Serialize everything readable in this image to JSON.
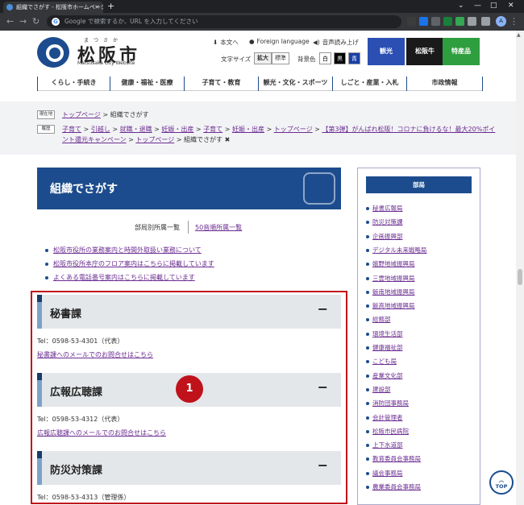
{
  "browser": {
    "tab_title": "組織でさがす - 松阪市ホームページ",
    "tab_close": "×",
    "new_tab": "+",
    "window_controls": [
      "⌄",
      "—",
      "□",
      "✕"
    ],
    "nav": [
      "←",
      "→",
      "↻"
    ],
    "omnibox_placeholder": "Google で検索するか、URL を入力してください",
    "google_glyph": "G",
    "profile_initial": "A"
  },
  "header": {
    "logo_ruby": "まつさか",
    "logo_name": "松阪市",
    "logo_sub": "Matsusaka City Website",
    "utils": [
      {
        "icon": "download-icon",
        "glyph": "⬇",
        "label": "本文へ"
      },
      {
        "icon": "globe-icon",
        "glyph": "●",
        "label": "Foreign language"
      },
      {
        "icon": "speaker-icon",
        "glyph": "◀)",
        "label": "音声読み上げ"
      }
    ],
    "font_size_label": "文字サイズ",
    "font_sizes": [
      "拡大",
      "標準"
    ],
    "bg_color_label": "背景色",
    "bg_colors": [
      {
        "label": "白",
        "bg": "#ffffff",
        "fg": "#000000"
      },
      {
        "label": "黒",
        "bg": "#000000",
        "fg": "#ffffff"
      },
      {
        "label": "青",
        "bg": "#1a3fa8",
        "fg": "#ffffff"
      }
    ],
    "banners": [
      {
        "label": "観光",
        "color": "#2b4fb3"
      },
      {
        "label": "松阪牛",
        "color": "#1a1a1a"
      },
      {
        "label": "特産品",
        "color": "#2e9e3e"
      }
    ]
  },
  "gnav": [
    "くらし・手続き",
    "健康・福祉・医療",
    "子育て・教育",
    "観光・文化・スポーツ",
    "しごと・産業・入札",
    "市政情報"
  ],
  "breadcrumbs": {
    "current_tag": "現在地",
    "history_tag": "履歴",
    "current": [
      {
        "text": "トップページ",
        "link": true
      },
      {
        "text": " > 組織でさがす",
        "link": false
      }
    ],
    "history": [
      {
        "text": "子育て",
        "link": true
      },
      {
        "text": " > ",
        "link": false
      },
      {
        "text": "引越し",
        "link": true
      },
      {
        "text": " > ",
        "link": false
      },
      {
        "text": "就職・退職",
        "link": true
      },
      {
        "text": " > ",
        "link": false
      },
      {
        "text": "妊娠・出産",
        "link": true
      },
      {
        "text": " > ",
        "link": false
      },
      {
        "text": "子育て",
        "link": true
      },
      {
        "text": " > ",
        "link": false
      },
      {
        "text": "妊娠・出産",
        "link": true
      },
      {
        "text": " > ",
        "link": false
      },
      {
        "text": "トップページ",
        "link": true
      },
      {
        "text": " > ",
        "link": false
      },
      {
        "text": "【第3弾】がんばれ松阪！コロナに負けるな！最大20%ポイント還元キャンペーン",
        "link": true
      },
      {
        "text": " > ",
        "link": false
      },
      {
        "text": "トップページ",
        "link": true
      },
      {
        "text": " > 組織でさがす ",
        "link": false
      }
    ],
    "clear_icon": "✖"
  },
  "main": {
    "title": "組織でさがす",
    "subtabs": [
      "部局別所属一覧",
      "50音順所属一覧"
    ],
    "links": [
      "松阪市役所の業務案内と時間外取扱い業務について",
      "松阪市役所本庁のフロア案内はこちらに掲載しています",
      "よくある電話番号案内はこちらに掲載しています"
    ],
    "sections": [
      {
        "name": "秘書課",
        "tel": "Tel：0598-53-4301（代表）",
        "mail": "秘書課へのメールでのお問合せはこちら"
      },
      {
        "name": "広報広聴課",
        "tel": "Tel：0598-53-4312（代表）",
        "mail": "広報広聴課へのメールでのお問合せはこちら"
      },
      {
        "name": "防災対策課",
        "tel": "Tel：0598-53-4313（管理係）",
        "mail": ""
      }
    ],
    "collapse_glyph": "−",
    "annotation": "1"
  },
  "sidebar": {
    "heading": "部局",
    "items": [
      "秘書広報局",
      "防災対策課",
      "企画振興部",
      "デジタル未来戦略局",
      "嬉野地域振興局",
      "三雲地域振興局",
      "飯南地域振興局",
      "飯高地域振興局",
      "総務部",
      "環境生活部",
      "健康福祉部",
      "こども局",
      "産業文化部",
      "建設部",
      "消防団事務局",
      "会計管理者",
      "松阪市民病院",
      "上下水道部",
      "教育委員会事務局",
      "議会事務局",
      "農業委員会事務局"
    ]
  },
  "totop": {
    "arrow": "︿",
    "label": "TOP"
  }
}
